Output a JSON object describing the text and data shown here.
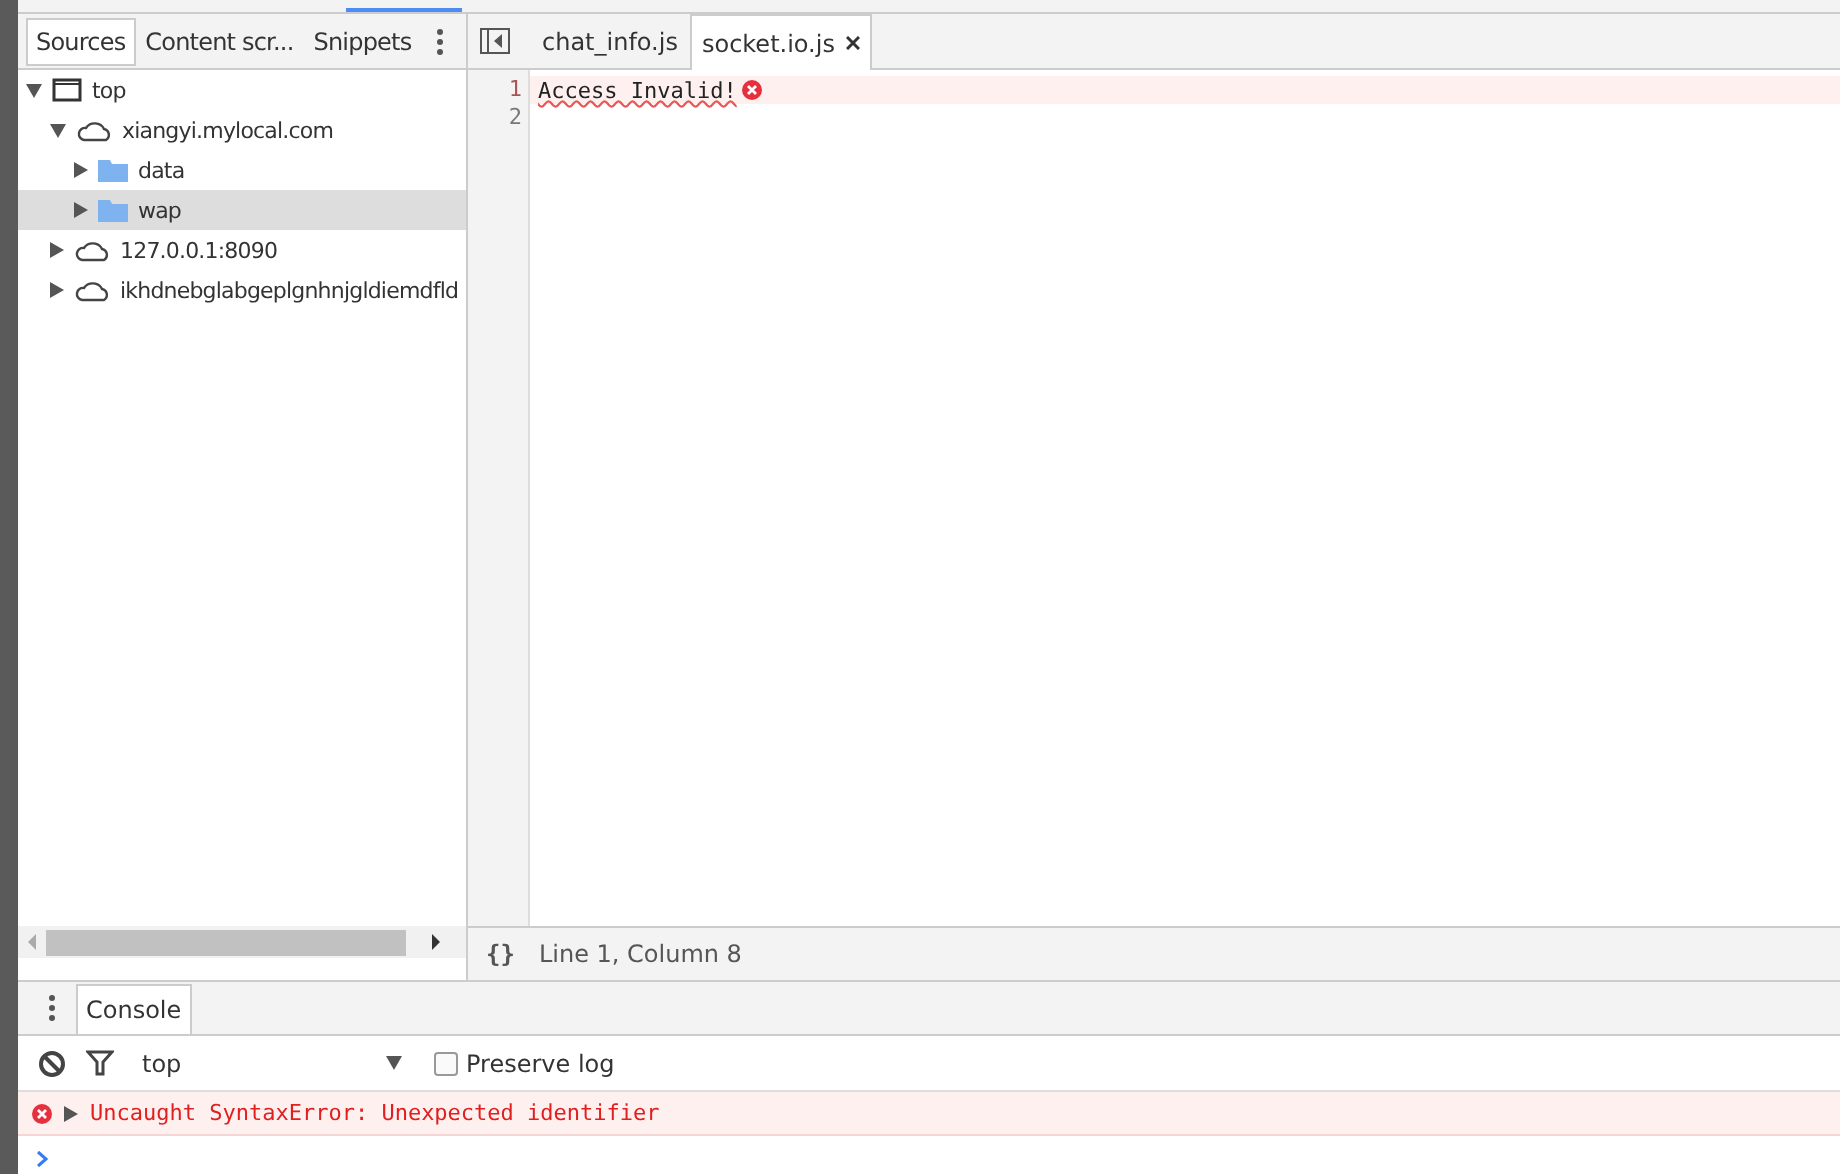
{
  "navigator": {
    "tabs": [
      {
        "label": "Sources",
        "selected": true
      },
      {
        "label": "Content scr...",
        "selected": false
      },
      {
        "label": "Snippets",
        "selected": false
      }
    ],
    "tree": [
      {
        "label": "top",
        "kind": "frame",
        "expanded": true,
        "selected": false,
        "children": [
          {
            "label": "xiangyi.mylocal.com",
            "kind": "domain",
            "expanded": true,
            "selected": false,
            "children": [
              {
                "label": "data",
                "kind": "folder",
                "expanded": false,
                "selected": false
              },
              {
                "label": "wap",
                "kind": "folder",
                "expanded": false,
                "selected": true
              }
            ]
          },
          {
            "label": "127.0.0.1:8090",
            "kind": "domain",
            "expanded": false,
            "selected": false
          },
          {
            "label": "ikhdnebglabgeplgnhnjgldiemdfld",
            "kind": "domain",
            "expanded": false,
            "selected": false
          }
        ]
      }
    ]
  },
  "editor": {
    "tabs": [
      {
        "label": "chat_info.js",
        "selected": false,
        "closable": false
      },
      {
        "label": "socket.io.js",
        "selected": true,
        "closable": true
      }
    ],
    "lines": [
      {
        "number": "1",
        "text": "Access Invalid!",
        "error": true
      },
      {
        "number": "2",
        "error": false
      }
    ],
    "format_button": "{}",
    "status": "Line 1, Column 8"
  },
  "drawer": {
    "tabs": [
      {
        "label": "Console",
        "selected": true
      }
    ],
    "context": "top",
    "preserve_log": {
      "label": "Preserve log",
      "checked": false
    },
    "messages": [
      {
        "kind": "error",
        "text": "Uncaught SyntaxError: Unexpected identifier"
      }
    ]
  }
}
